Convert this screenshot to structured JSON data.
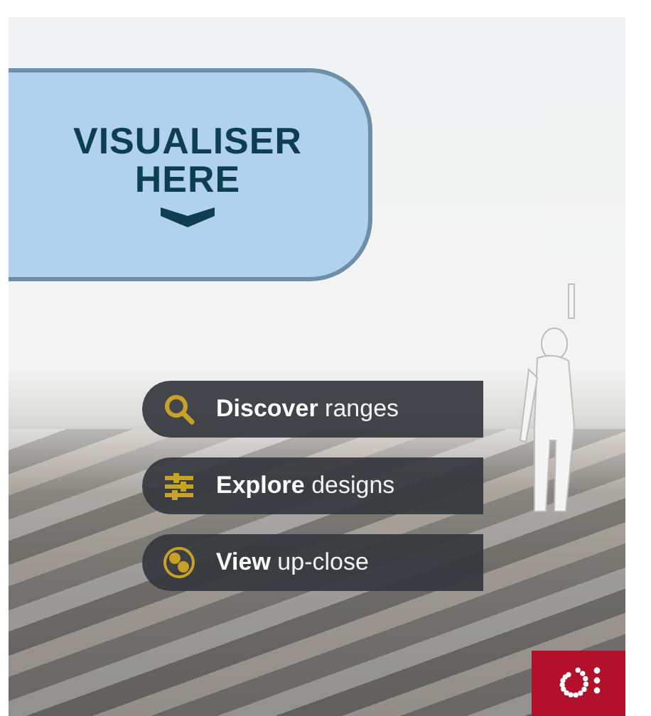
{
  "callout": {
    "lines": [
      "VISUALISER",
      "HERE"
    ]
  },
  "menu": [
    {
      "kind": "search",
      "label": "**Discover** ranges"
    },
    {
      "kind": "designs",
      "label": "**Explore** designs"
    },
    {
      "kind": "closeup",
      "label": "**View** up-close"
    }
  ]
}
